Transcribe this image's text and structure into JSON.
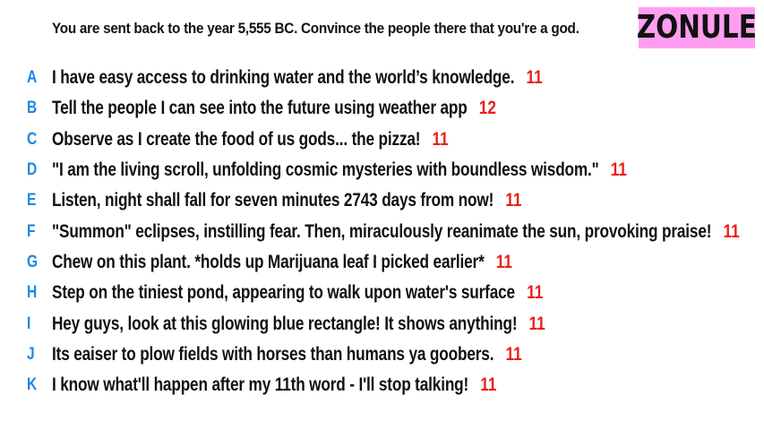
{
  "header": {
    "prompt": "You are sent back to the year 5,555 BC. Convince the people there that you're a god.",
    "brand": "ZONULE"
  },
  "colors": {
    "letter": "#1e88e5",
    "count": "#e8201a",
    "brand_bg": "#ff9ef0",
    "text": "#111111"
  },
  "answers": [
    {
      "letter": "A",
      "text": "I have easy access to drinking water and the world’s knowledge.",
      "count": "11"
    },
    {
      "letter": "B",
      "text": "Tell the people I can see into the future using weather app",
      "count": "12"
    },
    {
      "letter": "C",
      "text": "Observe as I create the food of us gods... the pizza!",
      "count": "11"
    },
    {
      "letter": "D",
      "text": "\"I am the living scroll, unfolding cosmic mysteries with boundless wisdom.\"",
      "count": "11"
    },
    {
      "letter": "E",
      "text": "Listen, night shall fall for seven minutes 2743 days from now!",
      "count": "11"
    },
    {
      "letter": "F",
      "text": "\"Summon\" eclipses, instilling fear. Then, miraculously reanimate the sun, provoking praise!",
      "count": "11"
    },
    {
      "letter": "G",
      "text": "Chew on this plant. *holds up Marijuana leaf I picked earlier*",
      "count": "11"
    },
    {
      "letter": "H",
      "text": "Step on the tiniest pond, appearing to walk upon water's surface",
      "count": "11"
    },
    {
      "letter": "I",
      "text": "Hey guys, look at this glowing blue rectangle! It shows anything!",
      "count": "11"
    },
    {
      "letter": "J",
      "text": "Its eaiser to plow fields with horses than humans ya goobers.",
      "count": "11"
    },
    {
      "letter": "K",
      "text": "I know what'll happen after my 11th word - I'll stop talking!",
      "count": "11"
    }
  ]
}
